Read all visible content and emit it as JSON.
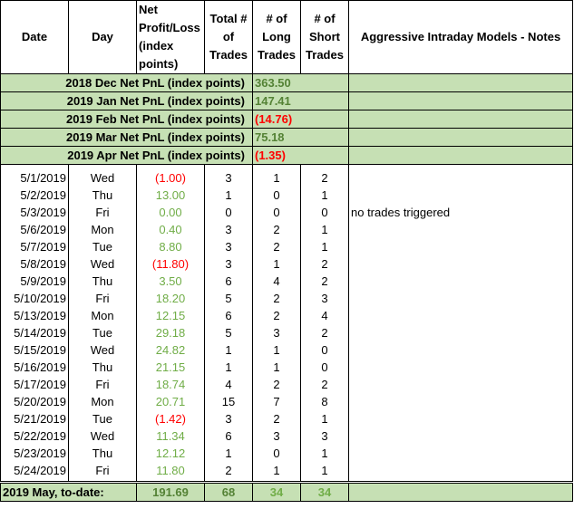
{
  "headers": {
    "date": "Date",
    "day": "Day",
    "pnl": "Net Profit/Loss (index points)",
    "total": "Total # of Trades",
    "long": "# of Long Trades",
    "short": "# of Short Trades",
    "notes": "Aggressive Intraday Models - Notes"
  },
  "summary": [
    {
      "label": "2018 Dec Net PnL (index points)",
      "value": "363.50",
      "sign": "pos"
    },
    {
      "label": "2019 Jan Net PnL (index points)",
      "value": "147.41",
      "sign": "pos"
    },
    {
      "label": "2019 Feb Net PnL (index points)",
      "value": "(14.76)",
      "sign": "neg"
    },
    {
      "label": "2019 Mar Net PnL (index points)",
      "value": "75.18",
      "sign": "pos"
    },
    {
      "label": "2019 Apr Net PnL (index points)",
      "value": "(1.35)",
      "sign": "neg"
    }
  ],
  "rows": [
    {
      "date": "5/1/2019",
      "day": "Wed",
      "pnl": "(1.00)",
      "sign": "neg",
      "total": "3",
      "long": "1",
      "short": "2",
      "note": ""
    },
    {
      "date": "5/2/2019",
      "day": "Thu",
      "pnl": "13.00",
      "sign": "pos",
      "total": "1",
      "long": "0",
      "short": "1",
      "note": ""
    },
    {
      "date": "5/3/2019",
      "day": "Fri",
      "pnl": "0.00",
      "sign": "pos",
      "total": "0",
      "long": "0",
      "short": "0",
      "note": "no trades triggered"
    },
    {
      "date": "5/6/2019",
      "day": "Mon",
      "pnl": "0.40",
      "sign": "pos",
      "total": "3",
      "long": "2",
      "short": "1",
      "note": ""
    },
    {
      "date": "5/7/2019",
      "day": "Tue",
      "pnl": "8.80",
      "sign": "pos",
      "total": "3",
      "long": "2",
      "short": "1",
      "note": ""
    },
    {
      "date": "5/8/2019",
      "day": "Wed",
      "pnl": "(11.80)",
      "sign": "neg",
      "total": "3",
      "long": "1",
      "short": "2",
      "note": ""
    },
    {
      "date": "5/9/2019",
      "day": "Thu",
      "pnl": "3.50",
      "sign": "pos",
      "total": "6",
      "long": "4",
      "short": "2",
      "note": ""
    },
    {
      "date": "5/10/2019",
      "day": "Fri",
      "pnl": "18.20",
      "sign": "pos",
      "total": "5",
      "long": "2",
      "short": "3",
      "note": ""
    },
    {
      "date": "5/13/2019",
      "day": "Mon",
      "pnl": "12.15",
      "sign": "pos",
      "total": "6",
      "long": "2",
      "short": "4",
      "note": ""
    },
    {
      "date": "5/14/2019",
      "day": "Tue",
      "pnl": "29.18",
      "sign": "pos",
      "total": "5",
      "long": "3",
      "short": "2",
      "note": ""
    },
    {
      "date": "5/15/2019",
      "day": "Wed",
      "pnl": "24.82",
      "sign": "pos",
      "total": "1",
      "long": "1",
      "short": "0",
      "note": ""
    },
    {
      "date": "5/16/2019",
      "day": "Thu",
      "pnl": "21.15",
      "sign": "pos",
      "total": "1",
      "long": "1",
      "short": "0",
      "note": ""
    },
    {
      "date": "5/17/2019",
      "day": "Fri",
      "pnl": "18.74",
      "sign": "pos",
      "total": "4",
      "long": "2",
      "short": "2",
      "note": ""
    },
    {
      "date": "5/20/2019",
      "day": "Mon",
      "pnl": "20.71",
      "sign": "pos",
      "total": "15",
      "long": "7",
      "short": "8",
      "note": ""
    },
    {
      "date": "5/21/2019",
      "day": "Tue",
      "pnl": "(1.42)",
      "sign": "neg",
      "total": "3",
      "long": "2",
      "short": "1",
      "note": ""
    },
    {
      "date": "5/22/2019",
      "day": "Wed",
      "pnl": "11.34",
      "sign": "pos",
      "total": "6",
      "long": "3",
      "short": "3",
      "note": ""
    },
    {
      "date": "5/23/2019",
      "day": "Thu",
      "pnl": "12.12",
      "sign": "pos",
      "total": "1",
      "long": "0",
      "short": "1",
      "note": ""
    },
    {
      "date": "5/24/2019",
      "day": "Fri",
      "pnl": "11.80",
      "sign": "pos",
      "total": "2",
      "long": "1",
      "short": "1",
      "note": ""
    }
  ],
  "total": {
    "label": "2019 May, to-date:",
    "pnl": "191.69",
    "trades": "68",
    "long": "34",
    "short": "34"
  },
  "colors": {
    "positive": "#548235",
    "negative": "#ff0000",
    "summary_bg": "#c6e0b4"
  }
}
